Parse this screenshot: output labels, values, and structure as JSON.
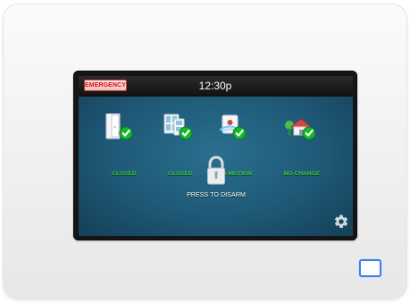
{
  "screen": {
    "emergency_label": "EMERGENCY",
    "time": "12:30p"
  },
  "statuses": [
    {
      "label": "CLOSED",
      "icon": "door-icon"
    },
    {
      "label": "CLOSED",
      "icon": "window-icon"
    },
    {
      "label": "NO MOTION",
      "icon": "motion-sensor-icon"
    },
    {
      "label": "NO CHANGE",
      "icon": "home-icon"
    }
  ],
  "lock": {
    "label": "PRESS TO DISARM",
    "icon": "padlock-icon"
  },
  "settings": {
    "icon": "gear-icon"
  },
  "device": {
    "indicator_icon": "status-square-icon"
  },
  "colors": {
    "screen_background": "#1f5a78",
    "top_bar": "#141414",
    "ok_green": "#33d33d",
    "emergency_red": "#d60f0f",
    "indicator_blue": "#3b7ff0"
  }
}
